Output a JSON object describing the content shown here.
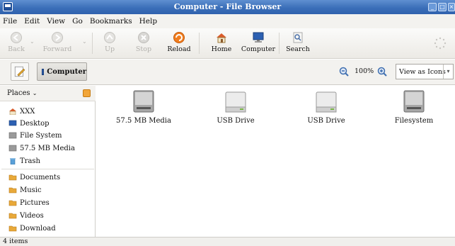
{
  "window": {
    "title": "Computer - File Browser",
    "buttons": {
      "minimize": "_",
      "maximize": "□",
      "close": "×"
    }
  },
  "menubar": [
    "File",
    "Edit",
    "View",
    "Go",
    "Bookmarks",
    "Help"
  ],
  "toolbar": {
    "back": "Back",
    "forward": "Forward",
    "up": "Up",
    "stop": "Stop",
    "reload": "Reload",
    "home": "Home",
    "computer": "Computer",
    "search": "Search"
  },
  "location": {
    "path_button": "Computer",
    "zoom_level": "100%",
    "view_mode": "View as Icons"
  },
  "sidebar": {
    "header": "Places",
    "items": [
      {
        "label": "XXX",
        "icon": "home-folder-icon"
      },
      {
        "label": "Desktop",
        "icon": "desktop-icon"
      },
      {
        "label": "File System",
        "icon": "filesystem-icon"
      },
      {
        "label": "57.5 MB Media",
        "icon": "drive-icon"
      },
      {
        "label": "Trash",
        "icon": "trash-icon"
      }
    ],
    "bookmarks": [
      {
        "label": "Documents",
        "icon": "folder-icon"
      },
      {
        "label": "Music",
        "icon": "folder-icon"
      },
      {
        "label": "Pictures",
        "icon": "folder-icon"
      },
      {
        "label": "Videos",
        "icon": "folder-icon"
      },
      {
        "label": "Download",
        "icon": "folder-icon"
      }
    ]
  },
  "devices": [
    {
      "name": "57.5 MB Media",
      "icon": "hard-drive-icon"
    },
    {
      "name": "USB Drive",
      "icon": "usb-drive-icon"
    },
    {
      "name": "USB Drive",
      "icon": "usb-drive-icon"
    },
    {
      "name": "Filesystem",
      "icon": "hard-drive-icon"
    }
  ],
  "status": "4 items",
  "colors": {
    "titlebar": "#3b6fb9",
    "folder": "#e8a93a",
    "accent": "#2c60b2"
  }
}
